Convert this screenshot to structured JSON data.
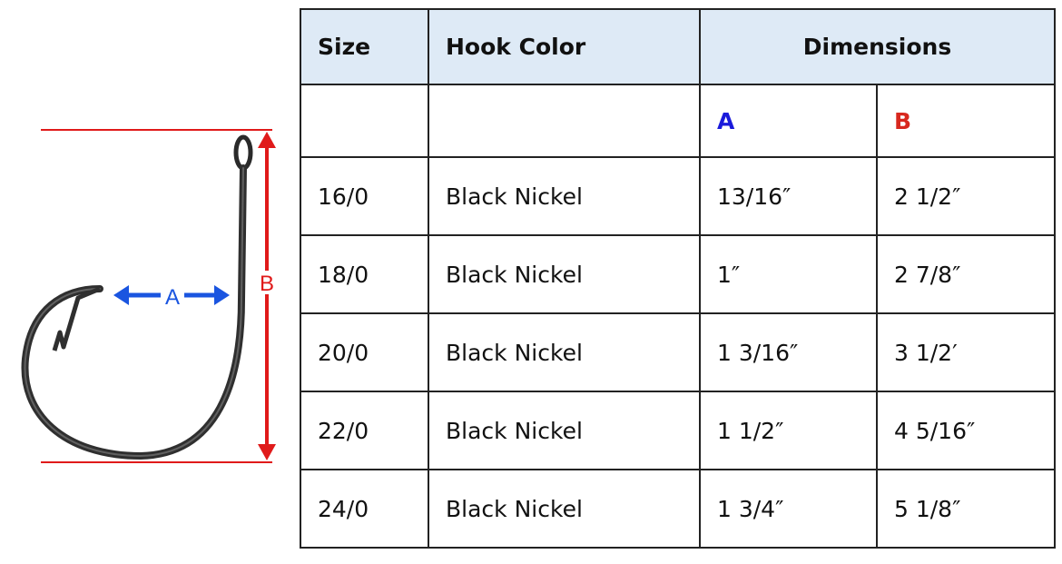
{
  "diagram": {
    "label_a": "A",
    "label_b": "B",
    "colors": {
      "a": "#1a55e0",
      "b": "#e01a1a",
      "hook": "#2a2a2a"
    }
  },
  "table": {
    "headers": {
      "size": "Size",
      "color": "Hook Color",
      "dimensions": "Dimensions"
    },
    "subheaders": {
      "a": "A",
      "b": "B"
    },
    "rows": [
      {
        "size": "16/0",
        "color": "Black Nickel",
        "a": "13/16″",
        "b": "2 1/2″"
      },
      {
        "size": "18/0",
        "color": "Black Nickel",
        "a": "1″",
        "b": "2 7/8″"
      },
      {
        "size": "20/0",
        "color": "Black Nickel",
        "a": "1 3/16″",
        "b": "3 1/2′"
      },
      {
        "size": "22/0",
        "color": "Black Nickel",
        "a": "1 1/2″",
        "b": "4 5/16″"
      },
      {
        "size": "24/0",
        "color": "Black Nickel",
        "a": "1 3/4″",
        "b": "5 1/8″"
      }
    ],
    "colors": {
      "header_bg": "#deeaf6",
      "a_label": "#1a1adb",
      "b_label": "#d8281e"
    }
  }
}
